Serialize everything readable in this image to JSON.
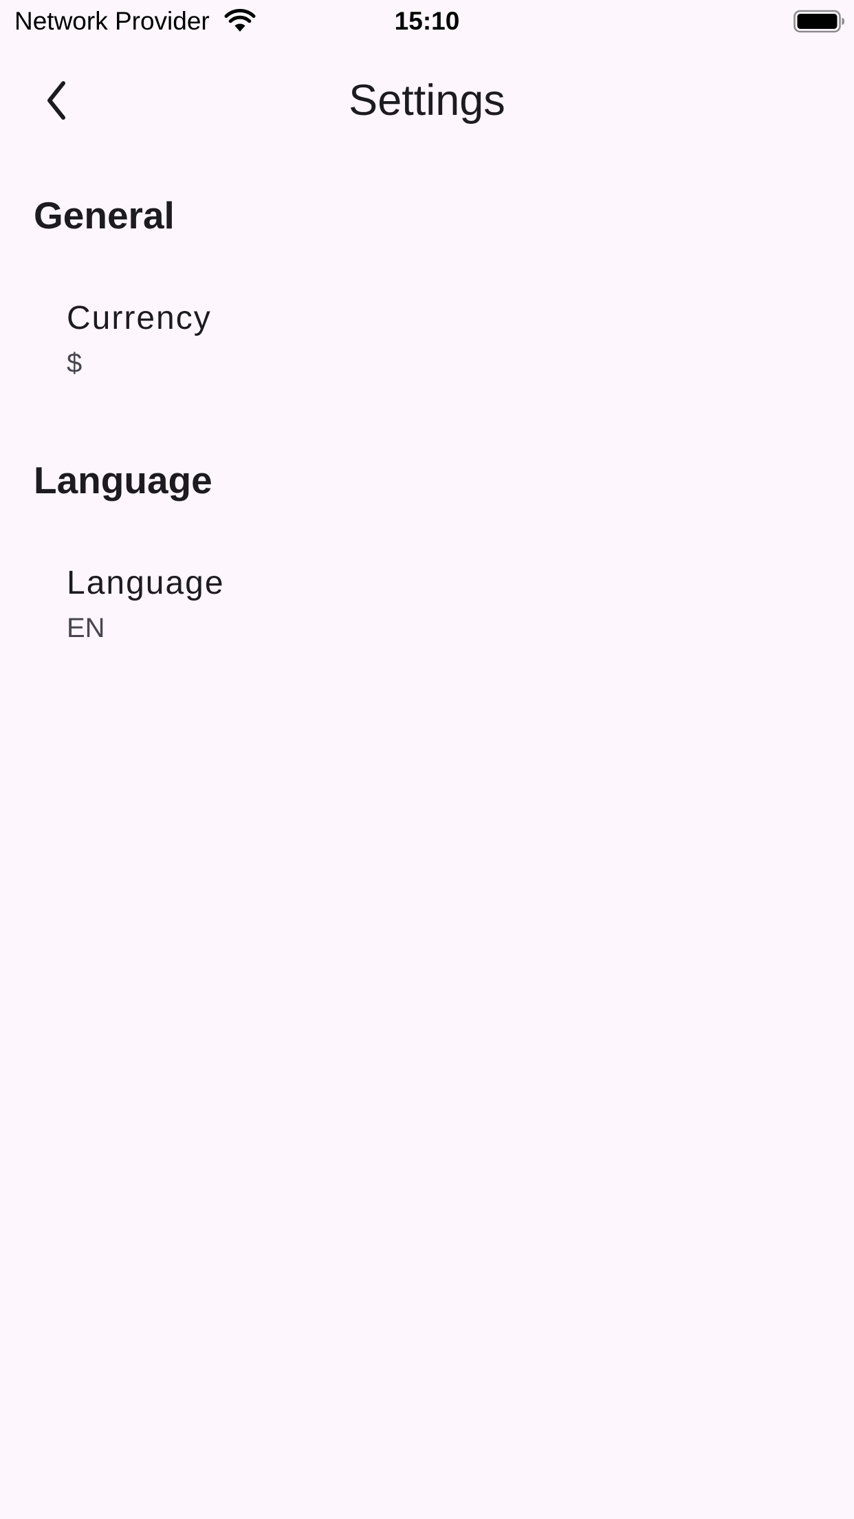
{
  "status_bar": {
    "carrier": "Network Provider",
    "time": "15:10",
    "wifi_icon": "wifi-icon",
    "battery_icon": "battery-full-icon"
  },
  "app_bar": {
    "back_icon": "chevron-left-icon",
    "title": "Settings"
  },
  "sections": [
    {
      "title": "General",
      "items": [
        {
          "label": "Currency",
          "value": "$"
        }
      ]
    },
    {
      "title": "Language",
      "items": [
        {
          "label": "Language",
          "value": "EN"
        }
      ]
    }
  ],
  "colors": {
    "background": "#fdf7fd",
    "text_primary": "#1d1b20",
    "text_secondary": "#49454f"
  }
}
